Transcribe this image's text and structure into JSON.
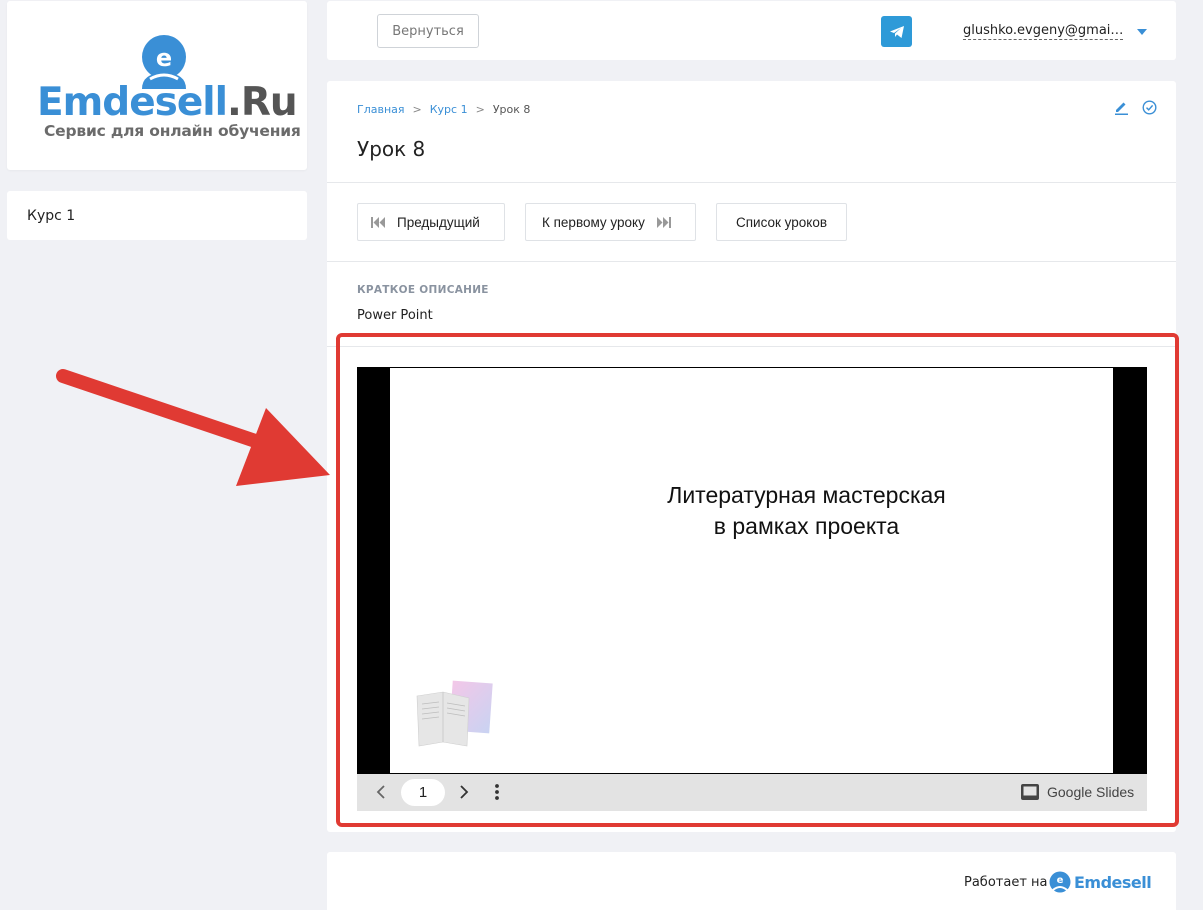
{
  "brand": {
    "title": "Emdesell",
    "title_suffix": ".Ru",
    "subtitle": "Сервис для онлайн обучения",
    "color": "#3a8fd6"
  },
  "sidebar": {
    "items": [
      {
        "label": "Курс 1"
      }
    ]
  },
  "header": {
    "back_label": "Вернуться",
    "telegram_icon": "telegram-icon",
    "user_email": "glushko.evgeny@gmai…"
  },
  "breadcrumb": [
    {
      "label": "Главная"
    },
    {
      "label": ">"
    },
    {
      "label": "Курс 1"
    },
    {
      "label": ">"
    },
    {
      "label": "Урок 8"
    }
  ],
  "lesson": {
    "title": "Урок 8",
    "nav": {
      "prev_label": "Предыдущий",
      "first_label": "К первому уроку",
      "list_label": "Список уроков"
    },
    "description_label": "КРАТКОЕ ОПИСАНИЕ",
    "description_value": "Power Point"
  },
  "slides": {
    "slide_title_line1": "Литературная мастерская",
    "slide_title_line2": "в рамках проекта",
    "page_number": "1",
    "provider_label": "Google Slides"
  },
  "annotation": {
    "highlight_color": "#e03a33"
  },
  "footer": {
    "powered_label": "Работает на",
    "powered_brand": "Emdesell"
  }
}
